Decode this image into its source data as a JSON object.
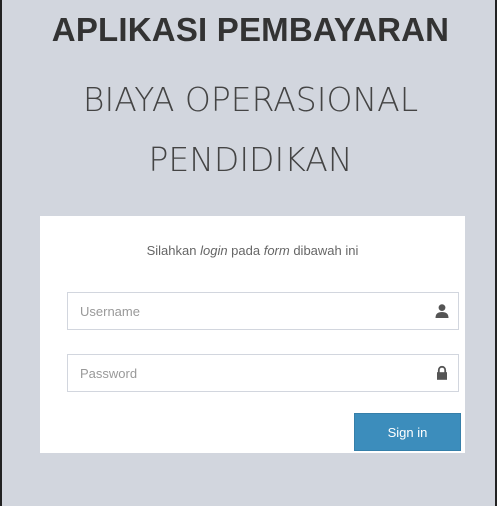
{
  "header": {
    "title": "APLIKASI PEMBAYARAN",
    "subtitle_line1": "BIAYA OPERASIONAL",
    "subtitle_line2": "PENDIDIKAN"
  },
  "login": {
    "message_part1": "Silahkan ",
    "message_login": "login",
    "message_part2": " pada ",
    "message_form": "form",
    "message_part3": " dibawah ini",
    "username_placeholder": "Username",
    "password_placeholder": "Password",
    "username_icon": "user-icon",
    "password_icon": "lock-icon",
    "signin_label": "Sign in"
  },
  "colors": {
    "background": "#d2d6de",
    "card": "#ffffff",
    "button": "#3c8dbc",
    "title": "#333333"
  }
}
